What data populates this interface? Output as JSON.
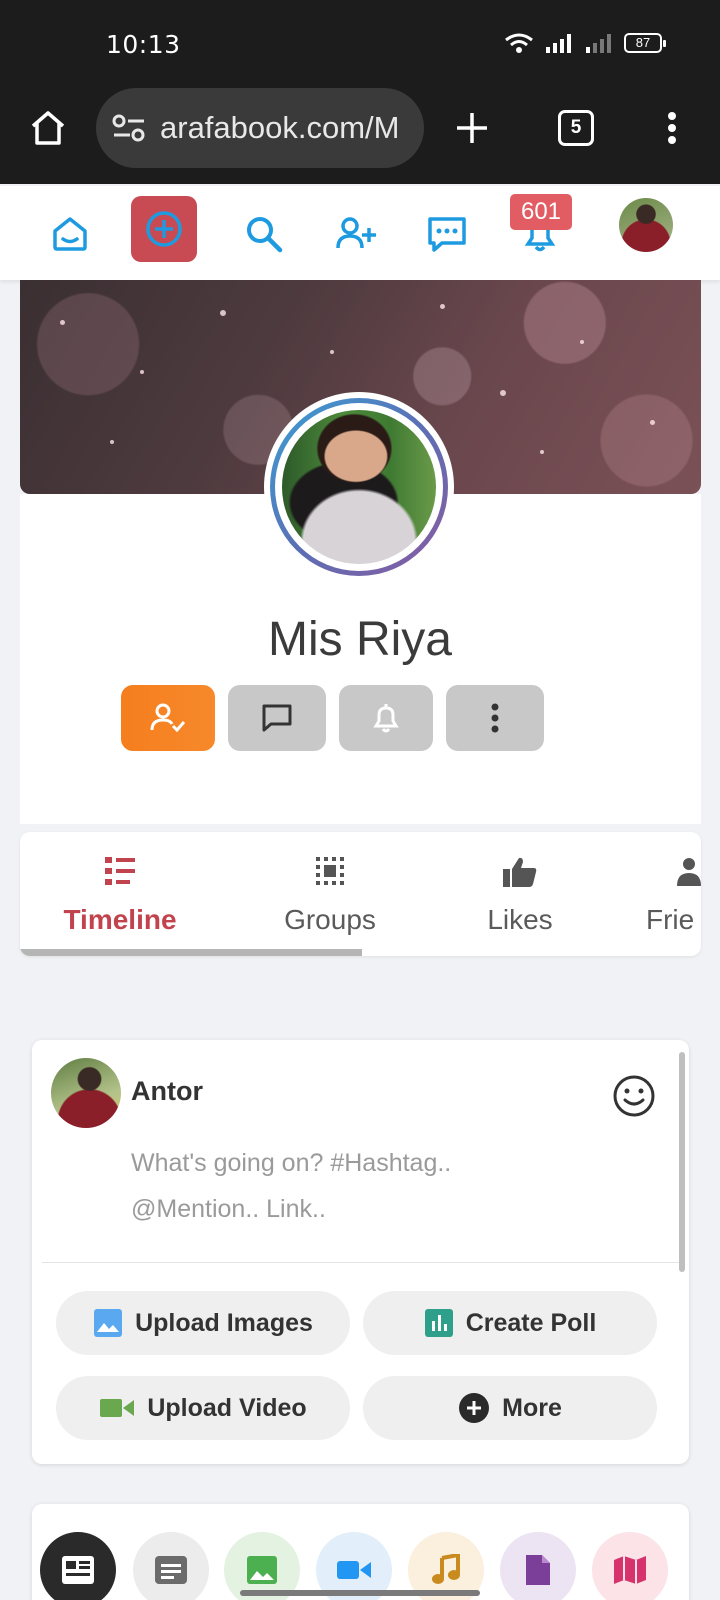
{
  "status_bar": {
    "time": "10:13",
    "battery": "87"
  },
  "browser": {
    "url": "arafabook.com/M",
    "tab_count": "5"
  },
  "app_nav": {
    "notifications_badge": "601"
  },
  "profile": {
    "name": "Mis Riya"
  },
  "tabs": [
    {
      "label": "Timeline",
      "icon": "timeline-icon",
      "active": true
    },
    {
      "label": "Groups",
      "icon": "groups-icon"
    },
    {
      "label": "Likes",
      "icon": "thumbs-up-icon"
    },
    {
      "label": "Frie",
      "icon": "friends-icon"
    }
  ],
  "composer": {
    "user_name": "Antor",
    "placeholder": "What's going on? #Hashtag.. @Mention.. Link..",
    "buttons": {
      "upload_images": "Upload Images",
      "create_poll": "Create Poll",
      "upload_video": "Upload Video",
      "more": "More"
    }
  },
  "colors": {
    "accent": "#c0434d",
    "nav_blue": "#1e9be0",
    "follow_orange": "#f57e1e",
    "badge_red": "#e25d63"
  }
}
